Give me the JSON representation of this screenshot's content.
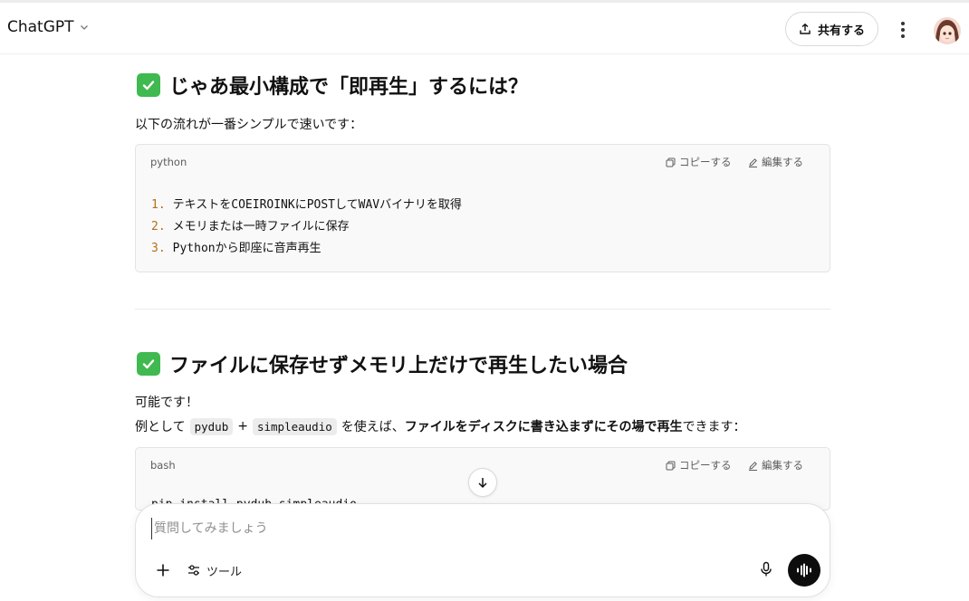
{
  "header": {
    "app_title": "ChatGPT",
    "share_label": "共有する"
  },
  "sections": [
    {
      "heading": "じゃあ最小構成で「即再生」するには？",
      "intro": "以下の流れが一番シンプルで速いです：",
      "code": {
        "lang": "python",
        "copy_label": "コピーする",
        "edit_label": "編集する",
        "lines": [
          {
            "num": "1.",
            "text": "テキストをCOEIROINKにPOSTしてWAVバイナリを取得"
          },
          {
            "num": "2.",
            "text": "メモリまたは一時ファイルに保存"
          },
          {
            "num": "3.",
            "text": "Pythonから即座に音声再生"
          }
        ]
      }
    },
    {
      "heading": "ファイルに保存せずメモリ上だけで再生したい場合",
      "line1": "可能です！",
      "line2": {
        "prefix": "例として",
        "code1": "pydub",
        "plus": "+",
        "code2": "simpleaudio",
        "mid": "を使えば、",
        "bold": "ファイルをディスクに書き込まずにその場で再生",
        "suffix": "できます："
      },
      "code": {
        "lang": "bash",
        "copy_label": "コピーする",
        "edit_label": "編集する",
        "partial_line": "pip install pydub simpleaudio"
      }
    }
  ],
  "composer": {
    "placeholder": "質問してみましょう",
    "tools_label": "ツール"
  },
  "icons": {
    "check": "check-square-icon",
    "share": "upload-icon",
    "more": "kebab-icon",
    "copy": "copy-icon",
    "edit": "pencil-icon",
    "scroll": "arrow-down-icon",
    "plus": "plus-icon",
    "tools": "sliders-icon",
    "mic": "mic-icon",
    "voice": "waveform-icon"
  },
  "colors": {
    "check_green": "#3fb950",
    "line_number": "#b3701a",
    "voice_button": "#0d0d0d"
  }
}
